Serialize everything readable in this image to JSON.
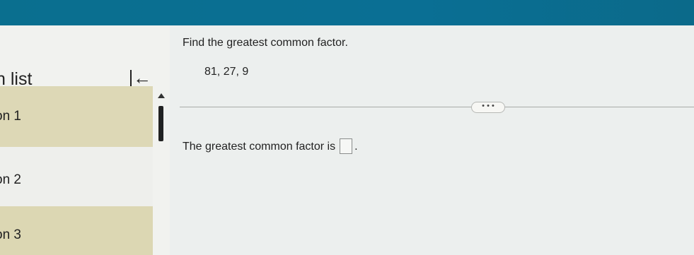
{
  "sidebar": {
    "title": "n list",
    "collapse_icon": "collapse-left-icon",
    "items": [
      {
        "label": "on 1"
      },
      {
        "label": "on 2"
      },
      {
        "label": "on 3"
      }
    ]
  },
  "question": {
    "prompt": "Find the greatest common factor.",
    "numbers": "81, 27, 9",
    "more_label": "• • •",
    "answer_prefix": "The greatest common factor is",
    "answer_value": "",
    "answer_suffix": "."
  },
  "colors": {
    "header": "#0a6f8f",
    "selected_item": "#ddd8b6"
  }
}
